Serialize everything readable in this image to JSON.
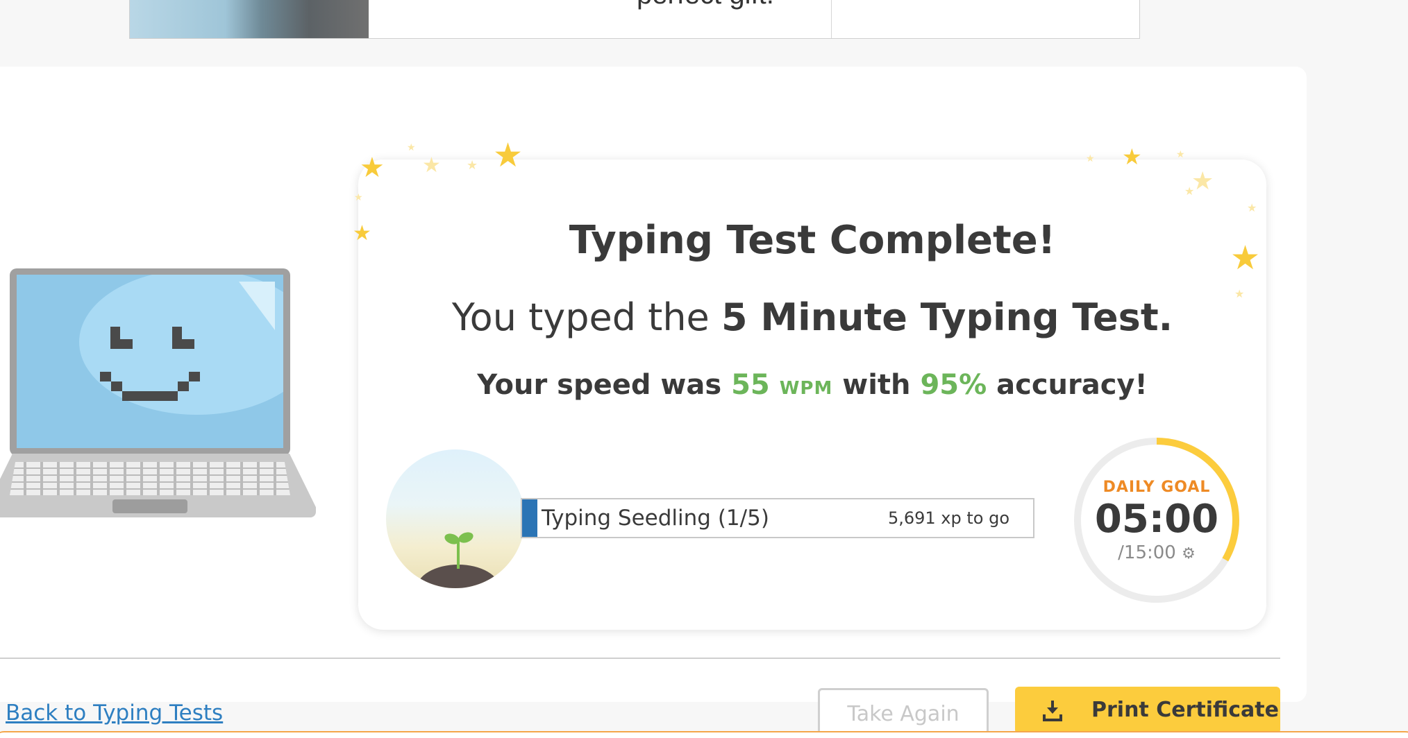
{
  "ad": {
    "partial_text": "perfect gift."
  },
  "result": {
    "title": "Typing Test Complete!",
    "subtitle_prefix": "You typed the ",
    "subtitle_test_name": "5 Minute Typing Test.",
    "speed_prefix": "Your speed was ",
    "speed_value": "55",
    "speed_unit": "WPM",
    "speed_middle": " with ",
    "accuracy_value": "95%",
    "speed_suffix": " accuracy!"
  },
  "level": {
    "label": "Typing Seedling (1/5)",
    "xp_remaining": "5,691 xp to go",
    "progress_fraction": 0.03,
    "badge_icon": "seedling-icon"
  },
  "daily_goal": {
    "label": "DAILY GOAL",
    "time": "05:00",
    "total": "/15:00",
    "progress_fraction": 0.333,
    "settings_icon": "gear-icon"
  },
  "actions": {
    "back_link": "Back to Typing Tests",
    "take_again": "Take Again",
    "print_certificate": "Print Certificate",
    "print_icon": "download-icon"
  },
  "colors": {
    "accent_green": "#6cb55a",
    "accent_yellow": "#fccc3d",
    "link_blue": "#2e7fc1",
    "progress_blue": "#2b74b5",
    "goal_orange": "#ee8a25"
  }
}
